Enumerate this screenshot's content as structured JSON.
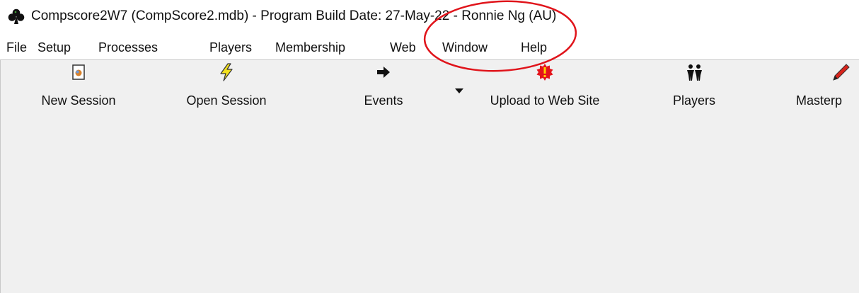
{
  "window": {
    "title": "Compscore2W7 (CompScore2.mdb) - Program Build Date: 27-May-22 - Ronnie Ng (AU)",
    "icon": "club-icon"
  },
  "menu": {
    "items": [
      "File",
      "Setup",
      "Processes",
      "Players",
      "Membership",
      "Web",
      "Window",
      "Help"
    ]
  },
  "toolbar": {
    "buttons": [
      {
        "label": "New Session",
        "icon": "new-document-icon"
      },
      {
        "label": "Open Session",
        "icon": "lightning-icon"
      },
      {
        "label": "Events",
        "icon": "arrow-right-icon"
      },
      {
        "label": "Upload to Web Site",
        "icon": "upload-alert-icon"
      },
      {
        "label": "Players",
        "icon": "people-icon"
      },
      {
        "label": "Masterp",
        "icon": "pencil-icon"
      }
    ],
    "events_dropdown_icon": "caret-down-icon"
  },
  "colors": {
    "annotation": "#e0141b",
    "workspace": "#f0f0f0",
    "lightning": "#f2e01e",
    "alert": "#e4141b",
    "pencil": "#d8241c"
  }
}
